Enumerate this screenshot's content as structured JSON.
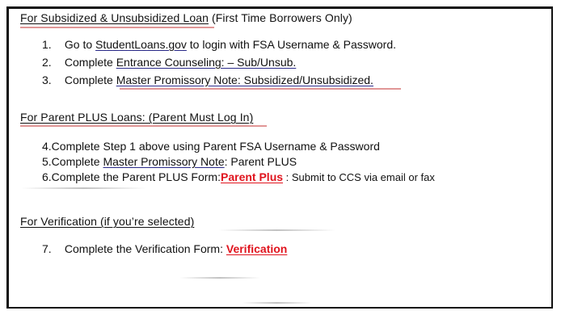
{
  "section1": {
    "heading_underlined": "For Subsidized & Unsubsidized Loan",
    "heading_rest": "(First Time Borrowers Only)",
    "items": [
      {
        "num": "1.",
        "pre": "Go to ",
        "link": "StudentLoans.gov",
        "post": " to login with FSA Username & Password."
      },
      {
        "num": "2.",
        "pre": "Complete ",
        "link": "Entrance Counseling: – Sub/Unsub.",
        "post": ""
      },
      {
        "num": "3.",
        "pre": "Complete ",
        "link": "Master Promissory Note: Subsidized/Unsubsidized.",
        "post": ""
      }
    ]
  },
  "section2": {
    "heading": "For Parent PLUS Loans: (Parent Must Log In)",
    "items": [
      {
        "text": "4.Complete Step 1 above using Parent FSA Username & Password"
      },
      {
        "pre": "5.Complete ",
        "link": "Master Promissory Note",
        "post": ": Parent PLUS"
      },
      {
        "pre": "6.Complete the Parent PLUS Form:",
        "link": "Parent Plus",
        "post": " : Submit to CCS via email or fax"
      }
    ]
  },
  "section3": {
    "heading": "For Verification (if you’re selected)",
    "item": {
      "num": "7.",
      "pre": "Complete the Verification Form: ",
      "link": "Verification"
    }
  },
  "colors": {
    "red_link": "#e0141e",
    "text": "#111111",
    "border": "#111111"
  }
}
